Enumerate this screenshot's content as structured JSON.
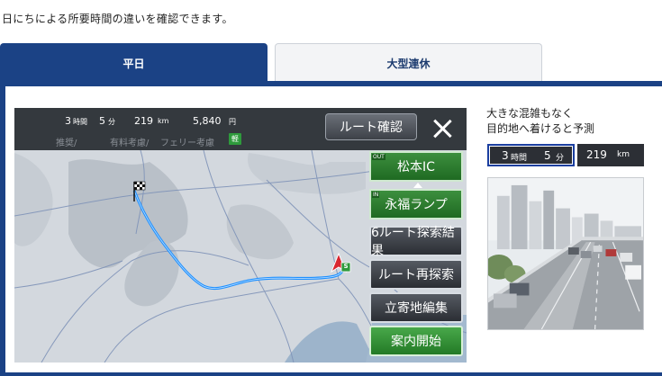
{
  "intro_text": "日にちによる所要時間の違いを確認できます。",
  "tabs": [
    {
      "label": "平日",
      "active": true
    },
    {
      "label": "大型連休",
      "active": false
    }
  ],
  "nav": {
    "header": {
      "hours": "3",
      "hours_unit": "時間",
      "minutes": "5",
      "minutes_unit": "分",
      "distance": "219",
      "distance_unit": "km",
      "toll": "5,840",
      "toll_unit": "円",
      "recommend_label": "推奨/",
      "toll_consider_label": "有料考慮/",
      "ferry_label": "フェリー考慮",
      "vehicle_badge": "軽"
    },
    "route_confirm_label": "ルート確認",
    "exit": {
      "tag": "OUT",
      "name": "松本IC"
    },
    "entrance": {
      "tag": "IN",
      "name": "永福ランプ"
    },
    "buttons": {
      "six_routes": "6ルート探索結果",
      "re_search": "ルート再探索",
      "waypoint_edit": "立寄地編集",
      "start_guidance": "案内開始"
    },
    "start_marker": "S"
  },
  "prediction": {
    "line1": "大きな混雑もなく",
    "line2": "目的地へ着けると予測",
    "hours": "3",
    "hours_unit": "時間",
    "minutes": "5",
    "minutes_unit": "分",
    "distance": "219",
    "distance_unit": "km"
  },
  "colors": {
    "tab_active": "#1b4285",
    "route_line": "#1e90ff",
    "button_green": "#2f8f33"
  }
}
